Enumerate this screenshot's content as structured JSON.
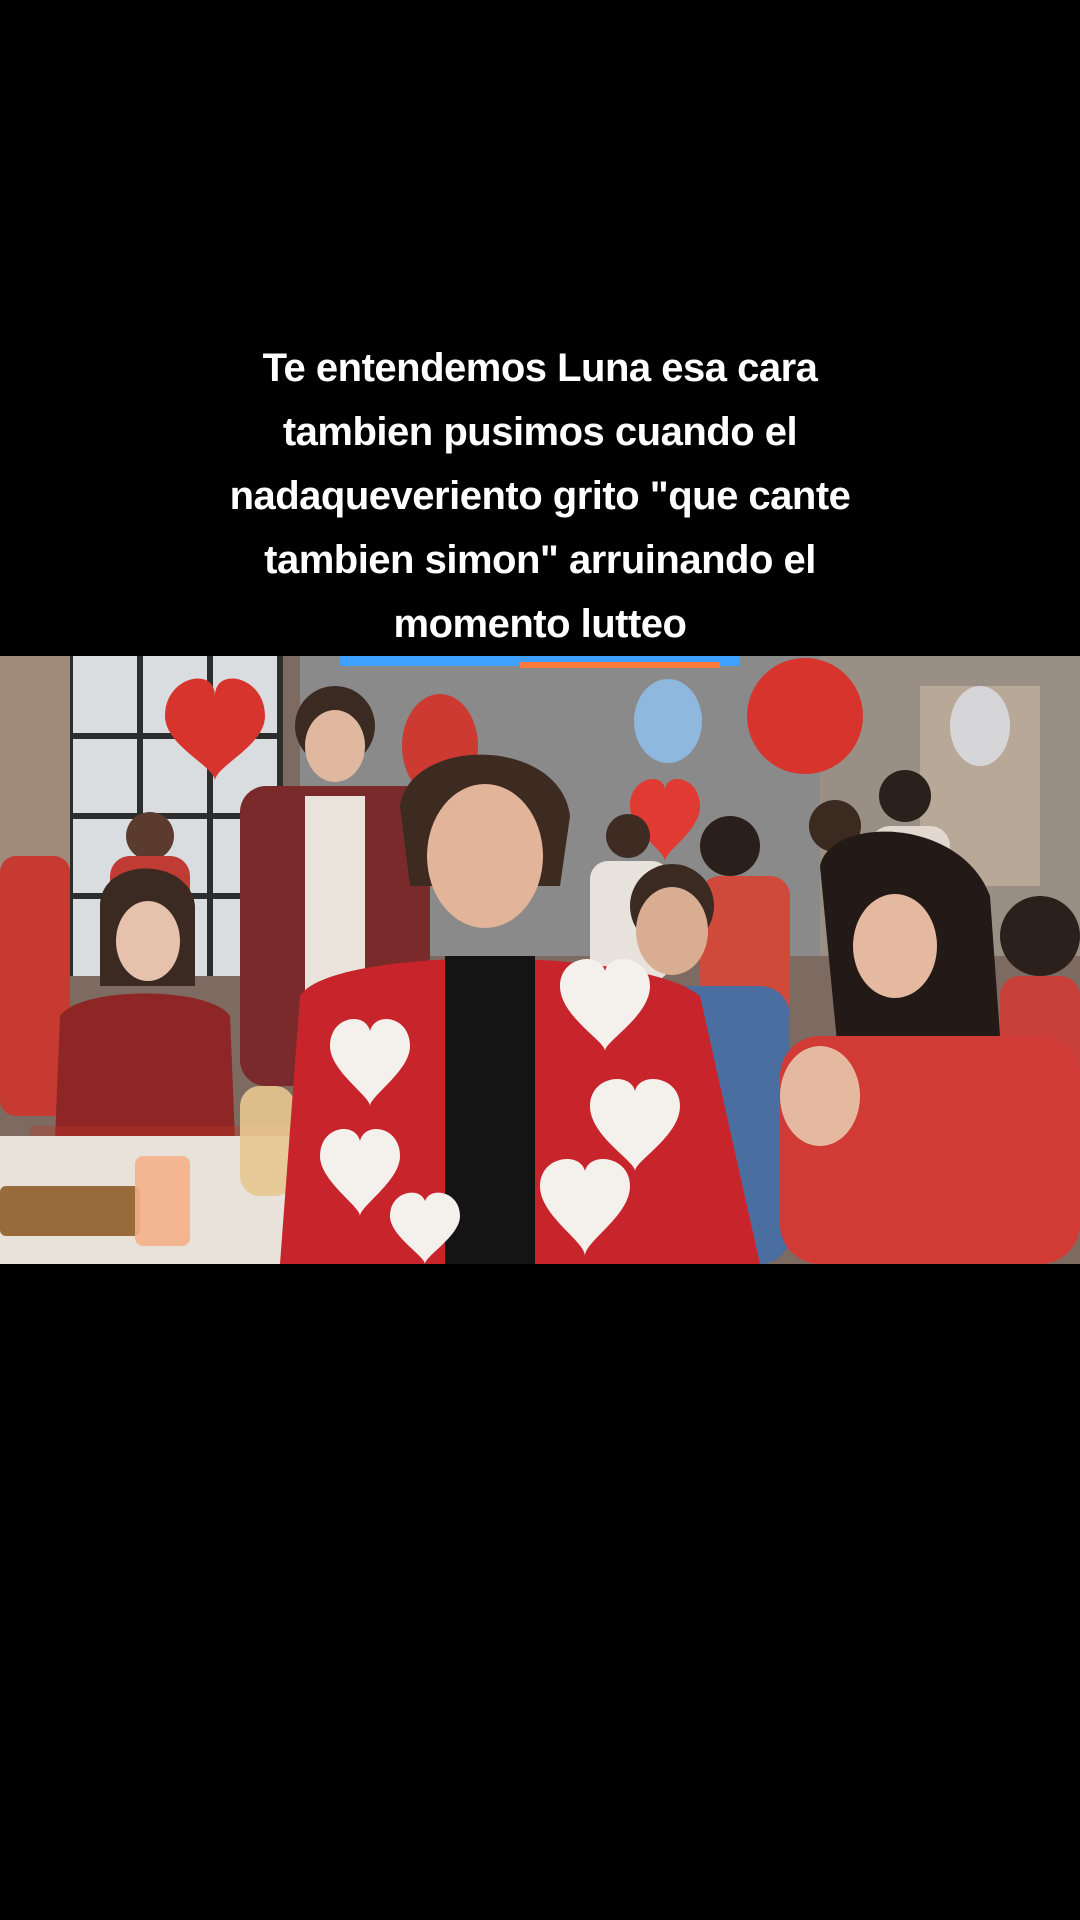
{
  "caption": {
    "lines": [
      "Te entendemos Luna esa cara",
      "tambien pusimos cuando el",
      "nadaqueveriento grito \"que cante",
      "tambien simon\" arruinando el",
      "momento lutteo"
    ]
  },
  "video": {
    "scene": "party-scene-still",
    "colors": {
      "background": "#000000",
      "jacket_red": "#c8242b",
      "balloon_red": "#d8342e",
      "balloon_blue": "#8fb8de",
      "neon_blue": "#3ea0ff"
    }
  }
}
